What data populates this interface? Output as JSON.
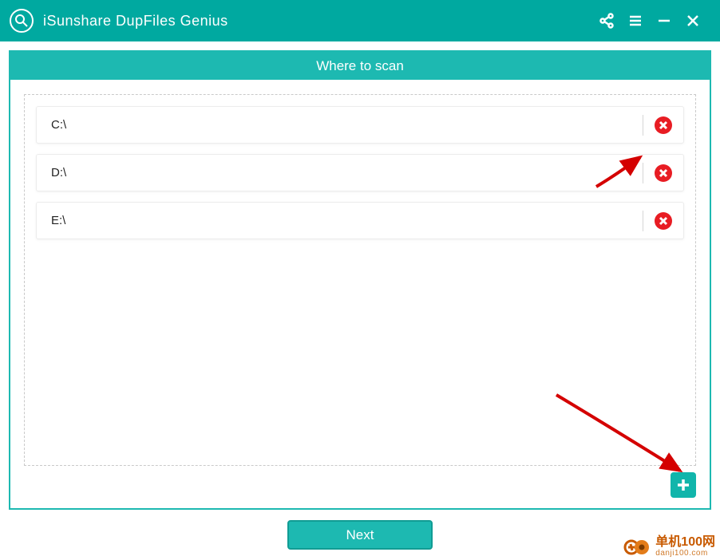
{
  "app": {
    "title": "iSunshare DupFiles Genius"
  },
  "stage": {
    "header": "Where to scan",
    "paths": [
      "C:\\",
      "D:\\",
      "E:\\"
    ]
  },
  "footer": {
    "next_label": "Next"
  },
  "watermark": {
    "line1": "单机100网",
    "line2": "danji100.com"
  }
}
